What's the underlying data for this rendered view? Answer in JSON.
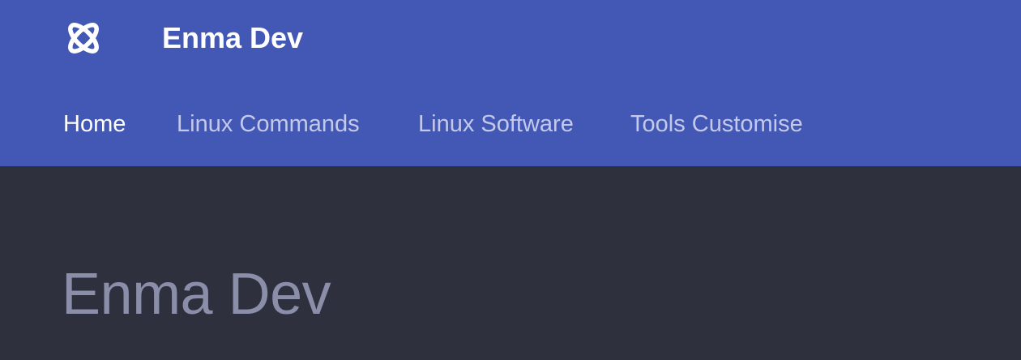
{
  "colors": {
    "header_background": "#4357b5",
    "content_background": "#2e303e",
    "title_text": "#ffffff",
    "tab_active": "#ffffff",
    "tab_inactive": "#c3c9ea",
    "hero_text": "#8a8ea8"
  },
  "header": {
    "logo_icon": "interlocking-rings-logo-icon",
    "title": "Enma Dev"
  },
  "nav": {
    "tabs": [
      {
        "label": "Home",
        "active": true
      },
      {
        "label": "Linux Commands",
        "active": false
      },
      {
        "label": "Linux Software",
        "active": false
      },
      {
        "label": "Tools Customise",
        "active": false
      }
    ]
  },
  "main": {
    "title": "Enma Dev"
  }
}
